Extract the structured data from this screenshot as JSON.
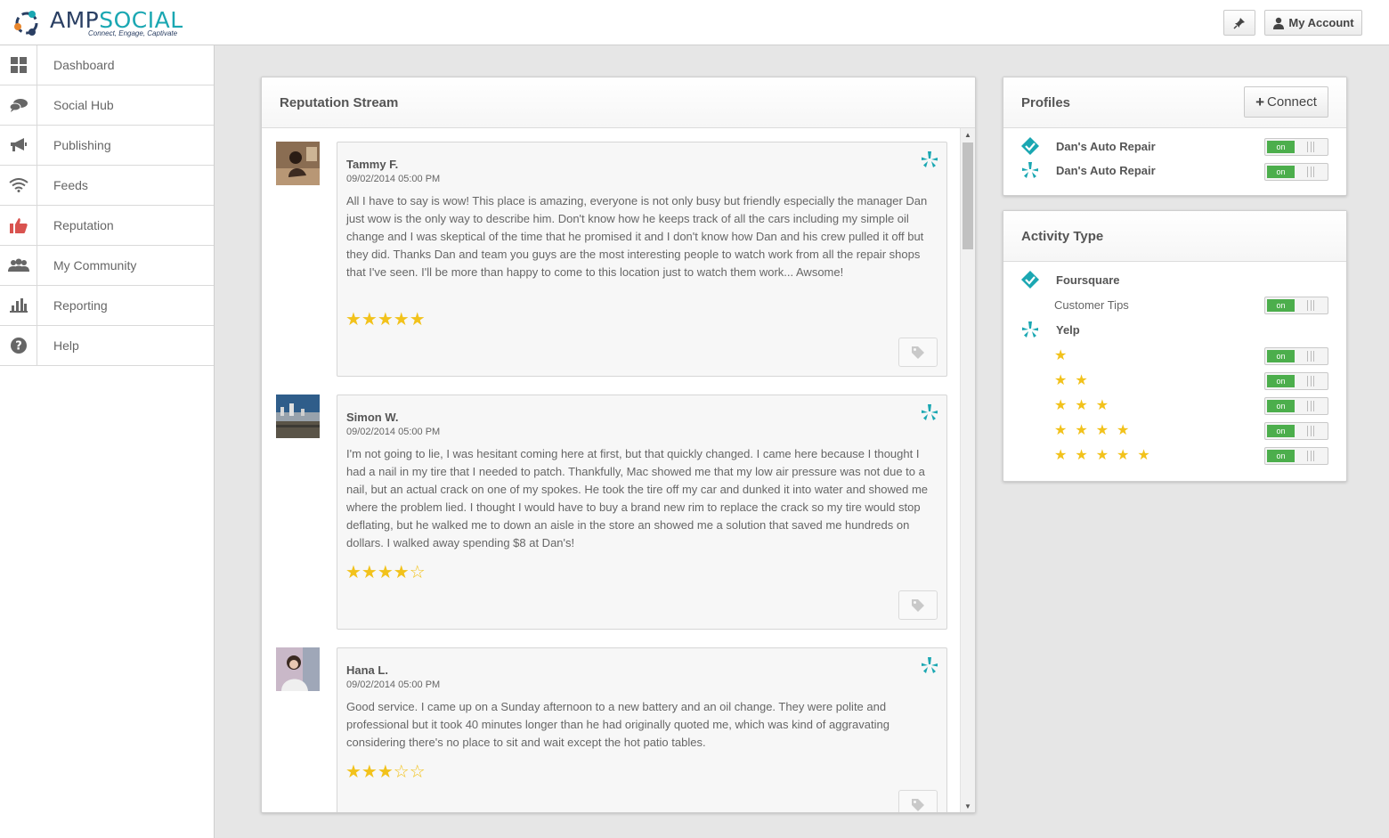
{
  "app": {
    "brand_part1": "AMP",
    "brand_part2": "SOCIAL",
    "tagline": "Connect, Engage, Captivate"
  },
  "header": {
    "pin_icon": "pin-icon",
    "account_label": "My Account"
  },
  "sidebar": {
    "items": [
      {
        "label": "Dashboard",
        "icon": "grid-icon"
      },
      {
        "label": "Social Hub",
        "icon": "chat-bubbles-icon"
      },
      {
        "label": "Publishing",
        "icon": "megaphone-icon"
      },
      {
        "label": "Feeds",
        "icon": "wifi-icon"
      },
      {
        "label": "Reputation",
        "icon": "thumbs-up-icon",
        "active": true
      },
      {
        "label": "My Community",
        "icon": "people-icon"
      },
      {
        "label": "Reporting",
        "icon": "bar-chart-icon"
      },
      {
        "label": "Help",
        "icon": "question-icon"
      }
    ]
  },
  "stream": {
    "title": "Reputation Stream",
    "reviews": [
      {
        "name": "Tammy F.",
        "date": "09/02/2014 05:00 PM",
        "text": "All I have to say is wow! This place is amazing, everyone is not only busy but friendly especially the manager Dan just wow is the only way to describe him. Don't know how he keeps track of all the cars including my simple oil change and I was skeptical of the time that he promised it and I don't know how Dan and his crew pulled it off but they did. Thanks Dan and team you guys are the most interesting people to watch work from all the repair shops that I've seen. I'll be more than happy to come to this location just to watch them work... Awsome!",
        "rating": 5,
        "stars": "★★★★★",
        "source_icon": "yelp-icon"
      },
      {
        "name": "Simon W.",
        "date": "09/02/2014 05:00 PM",
        "text": "I'm not going to lie, I was hesitant coming here at first, but that quickly changed. I came here because I thought I had a nail in my tire that I needed to patch. Thankfully, Mac showed me that my low air pressure was not due to a nail, but an actual crack on one of my spokes. He took the tire off my car and dunked it into water and showed me where the problem lied. I thought I would have to buy a brand new rim to replace the crack so my tire would stop deflating, but he walked me to down an aisle in the store an showed me a solution that saved me hundreds on dollars. I walked away spending $8 at Dan's!",
        "rating": 4,
        "stars": "★★★★☆",
        "source_icon": "yelp-icon"
      },
      {
        "name": "Hana L.",
        "date": "09/02/2014 05:00 PM",
        "text": "Good service. I came up on a Sunday afternoon to a new battery and an oil change. They were polite and professional but it took 40 minutes longer than he had originally quoted me, which was kind of aggravating considering there's no place to sit and wait except the hot patio tables.",
        "rating": 3,
        "stars": "★★★☆☆",
        "source_icon": "yelp-icon"
      }
    ]
  },
  "profiles": {
    "title": "Profiles",
    "connect_label": "Connect",
    "items": [
      {
        "name": "Dan's Auto Repair",
        "icon": "foursquare-icon",
        "toggle": "on"
      },
      {
        "name": "Dan's Auto Repair",
        "icon": "yelp-icon",
        "toggle": "on"
      }
    ]
  },
  "activity": {
    "title": "Activity Type",
    "foursquare": {
      "label": "Foursquare",
      "icon": "foursquare-icon",
      "tips_label": "Customer Tips",
      "toggle": "on"
    },
    "yelp": {
      "label": "Yelp",
      "icon": "yelp-icon"
    },
    "star_filters": [
      {
        "stars": "★",
        "rating": 1,
        "toggle": "on"
      },
      {
        "stars": "★★",
        "rating": 2,
        "toggle": "on"
      },
      {
        "stars": "★★★",
        "rating": 3,
        "toggle": "on"
      },
      {
        "stars": "★★★★",
        "rating": 4,
        "toggle": "on"
      },
      {
        "stars": "★★★★★",
        "rating": 5,
        "toggle": "on"
      }
    ]
  },
  "colors": {
    "accent": "#1aa7b2",
    "star": "#f2c21b",
    "toggle_on": "#4cae4c",
    "reputation_icon": "#d9534f"
  }
}
